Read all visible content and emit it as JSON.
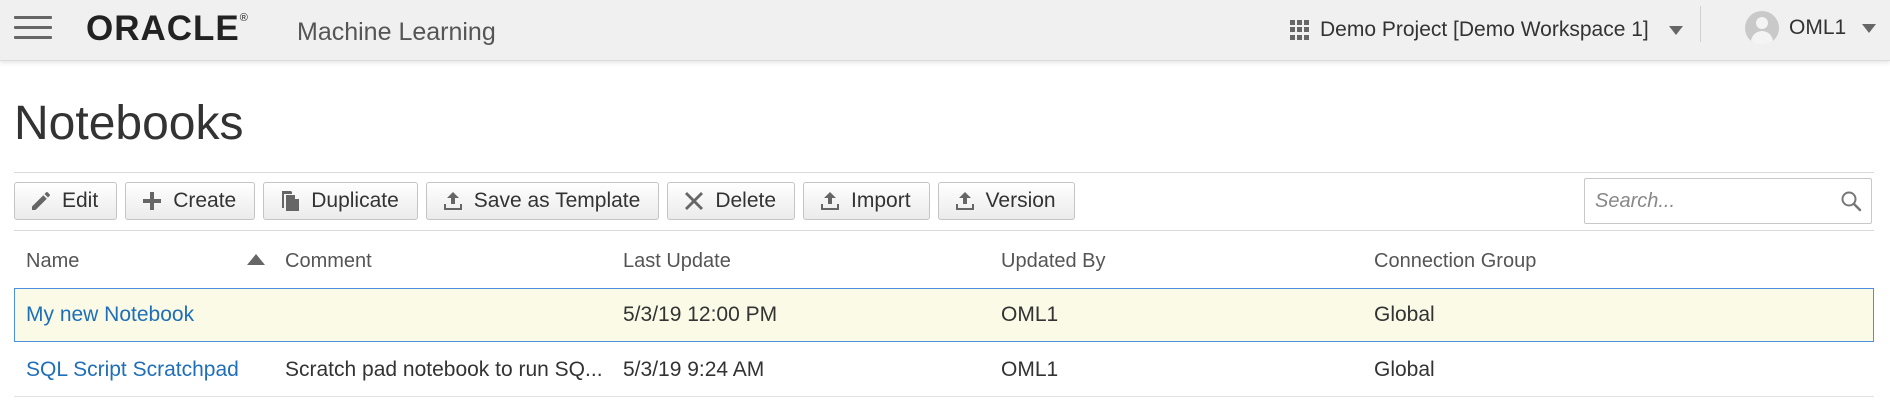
{
  "header": {
    "brand": "ORACLE",
    "brand_mark": "®",
    "app_name": "Machine Learning",
    "project": "Demo Project [Demo Workspace 1]",
    "user": "OML1"
  },
  "page": {
    "title": "Notebooks"
  },
  "toolbar": {
    "edit": "Edit",
    "create": "Create",
    "duplicate": "Duplicate",
    "save_template": "Save as Template",
    "delete": "Delete",
    "import": "Import",
    "version": "Version"
  },
  "search": {
    "placeholder": "Search..."
  },
  "table": {
    "columns": [
      "Name",
      "Comment",
      "Last Update",
      "Updated By",
      "Connection Group"
    ],
    "sort": {
      "column": "Name",
      "direction": "ascending"
    },
    "rows": [
      {
        "name": "My new Notebook",
        "comment": "",
        "last_update": "5/3/19 12:00 PM",
        "updated_by": "OML1",
        "group": "Global",
        "selected": true
      },
      {
        "name": "SQL Script Scratchpad",
        "comment": "Scratch pad notebook to run SQ...",
        "last_update": "5/3/19 9:24 AM",
        "updated_by": "OML1",
        "group": "Global",
        "selected": false
      }
    ]
  },
  "colors": {
    "link": "#1f6fb8",
    "selected_row_bg": "#fafae6",
    "selected_row_border": "#4a90e2",
    "header_bg": "#f0f0f0"
  }
}
